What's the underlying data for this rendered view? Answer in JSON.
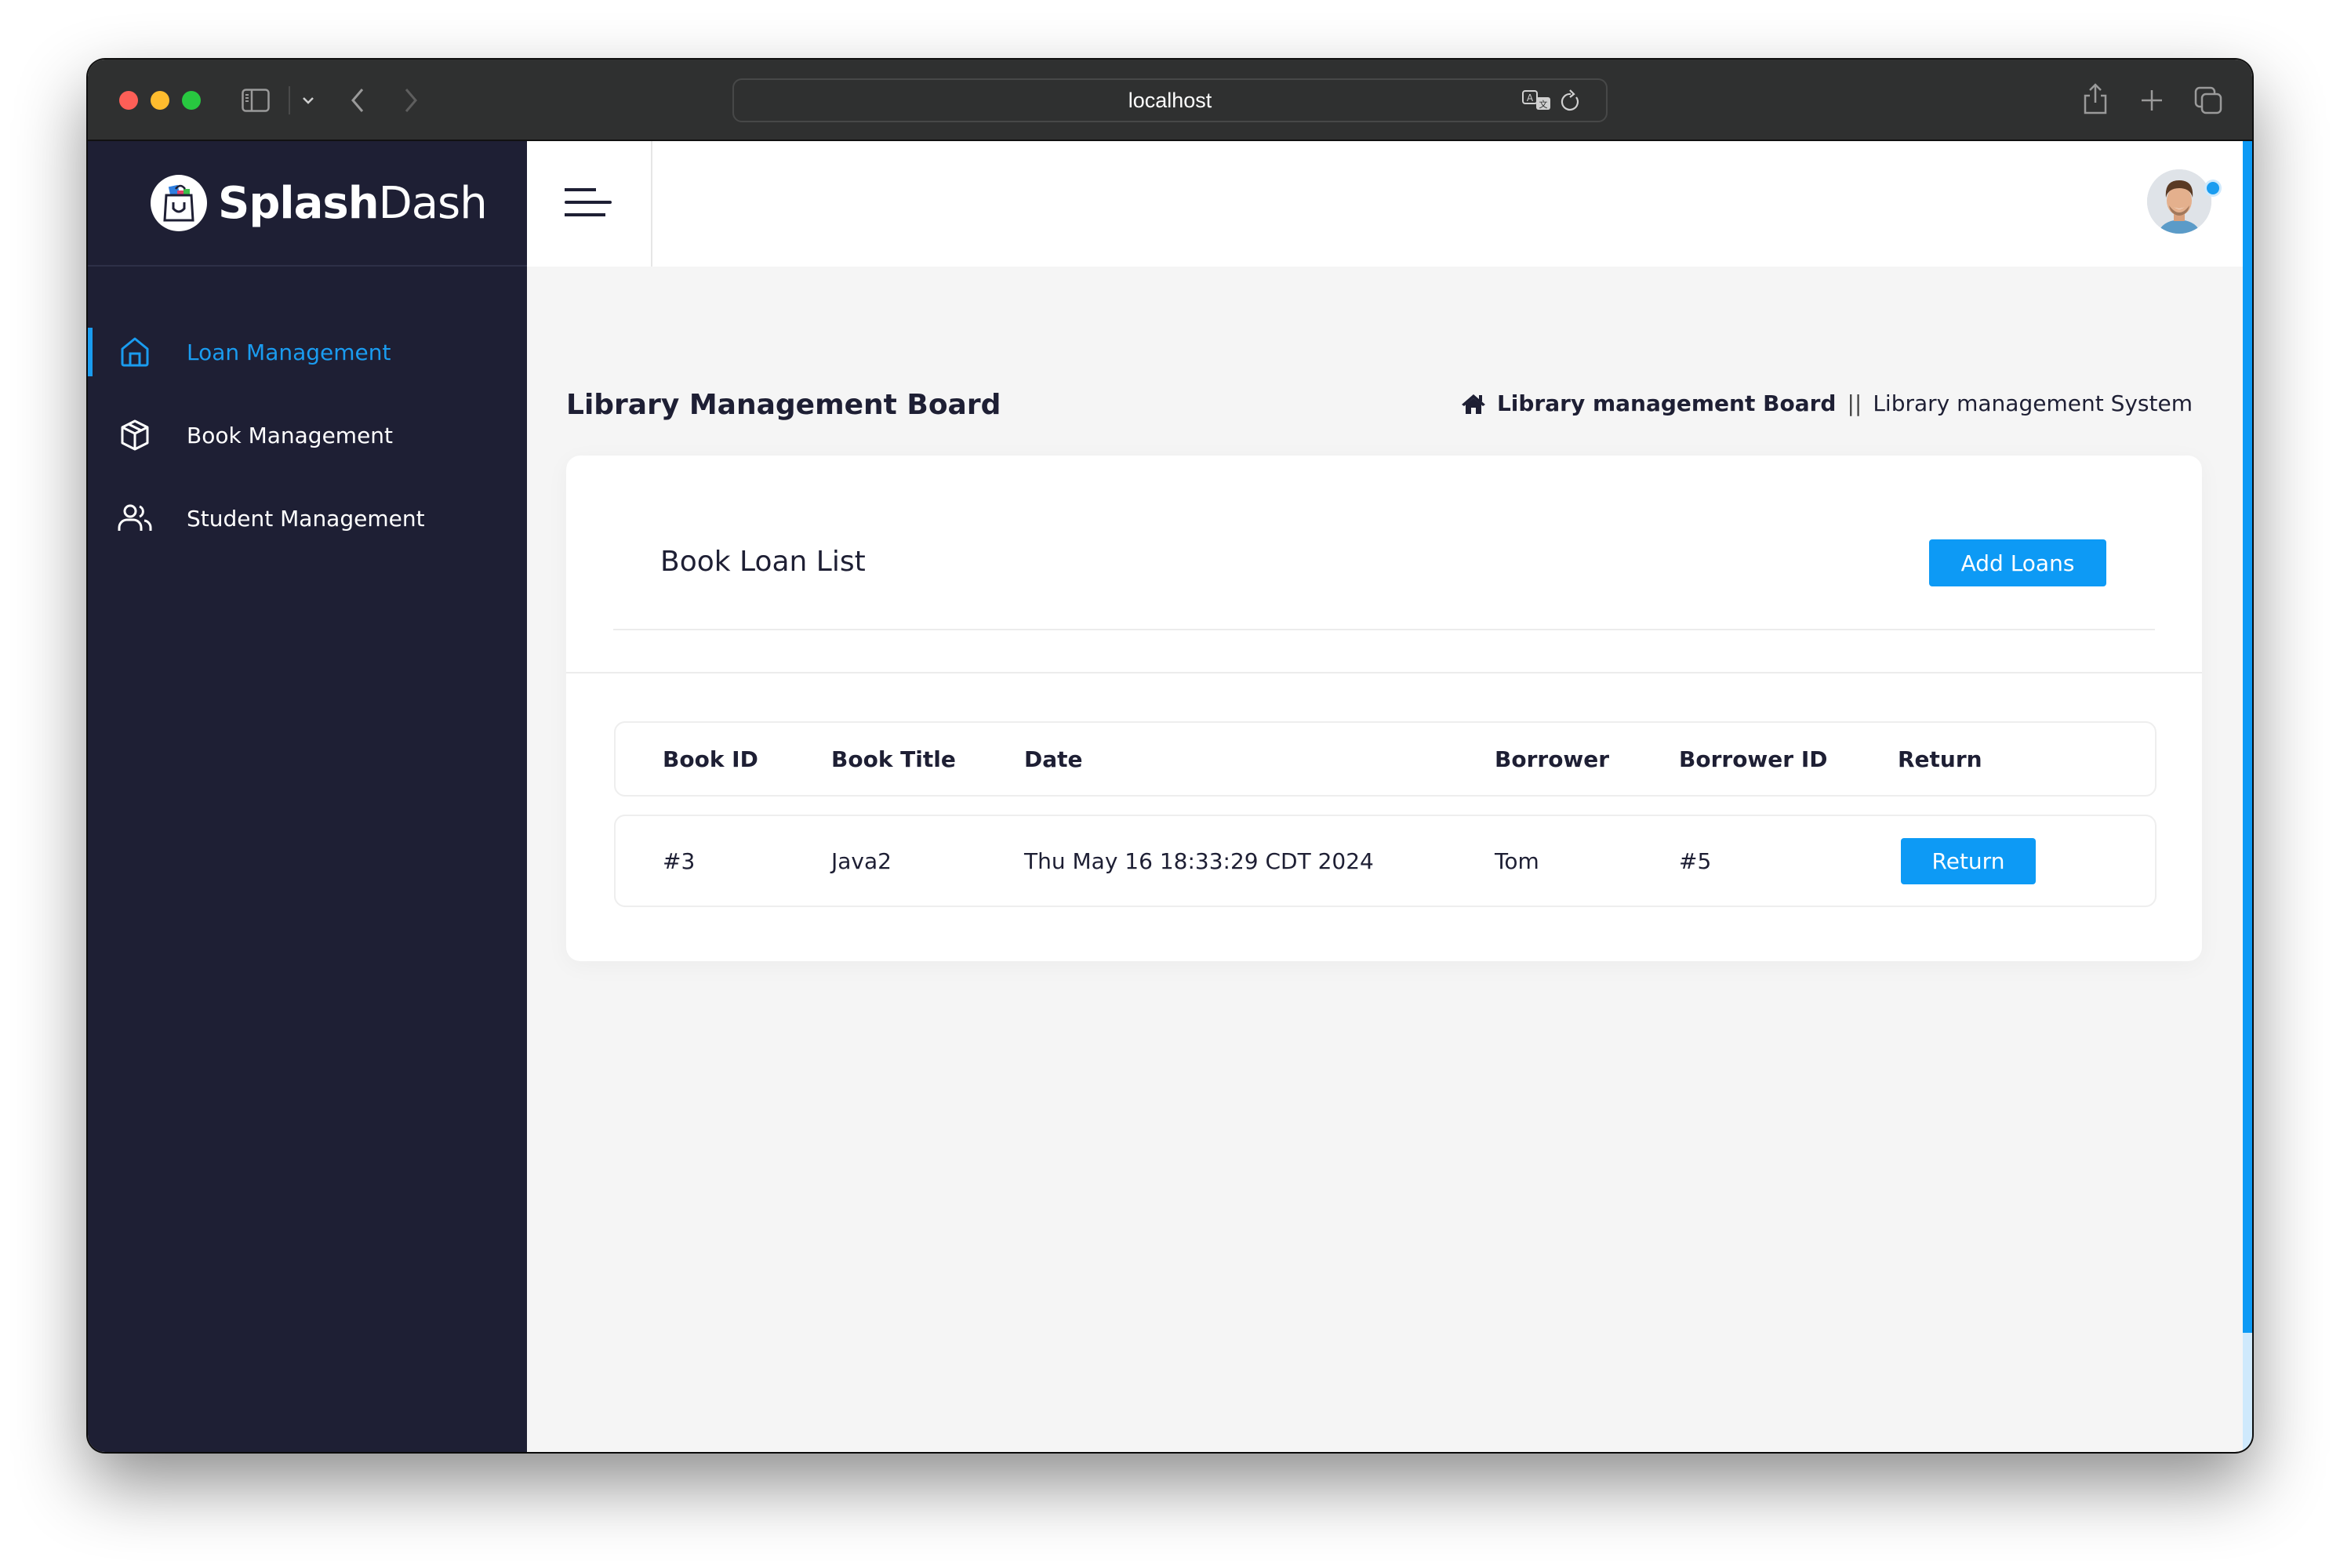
{
  "browser": {
    "url": "localhost",
    "icons": [
      "sidebar-toggle-icon",
      "chevron-down-icon",
      "back-icon",
      "forward-icon",
      "translate-icon",
      "reload-icon",
      "share-icon",
      "new-tab-icon",
      "tabs-overview-icon"
    ]
  },
  "brand": {
    "name_bold": "Splash",
    "name_regular": "Dash"
  },
  "sidebar": {
    "items": [
      {
        "label": "Loan Management",
        "icon": "home-icon",
        "active": true
      },
      {
        "label": "Book Management",
        "icon": "box-icon",
        "active": false
      },
      {
        "label": "Student Management",
        "icon": "users-icon",
        "active": false
      }
    ]
  },
  "colors": {
    "accent": "#0d9af5",
    "sidebar_bg": "#1e1f34",
    "titlebar_bg": "#2f3030",
    "main_bg": "#f5f5f5"
  },
  "page": {
    "title": "Library Management Board",
    "breadcrumb": {
      "current": "Library management Board",
      "separator": "||",
      "parent": "Library management System"
    }
  },
  "card": {
    "title": "Book Loan List",
    "add_button": "Add Loans"
  },
  "table": {
    "headers": [
      "Book ID",
      "Book Title",
      "Date",
      "Borrower",
      "Borrower ID",
      "Return"
    ],
    "rows": [
      {
        "book_id": "#3",
        "book_title": "Java2",
        "date": "Thu May 16 18:33:29 CDT 2024",
        "borrower": "Tom",
        "borrower_id": "#5",
        "action": "Return"
      }
    ]
  }
}
